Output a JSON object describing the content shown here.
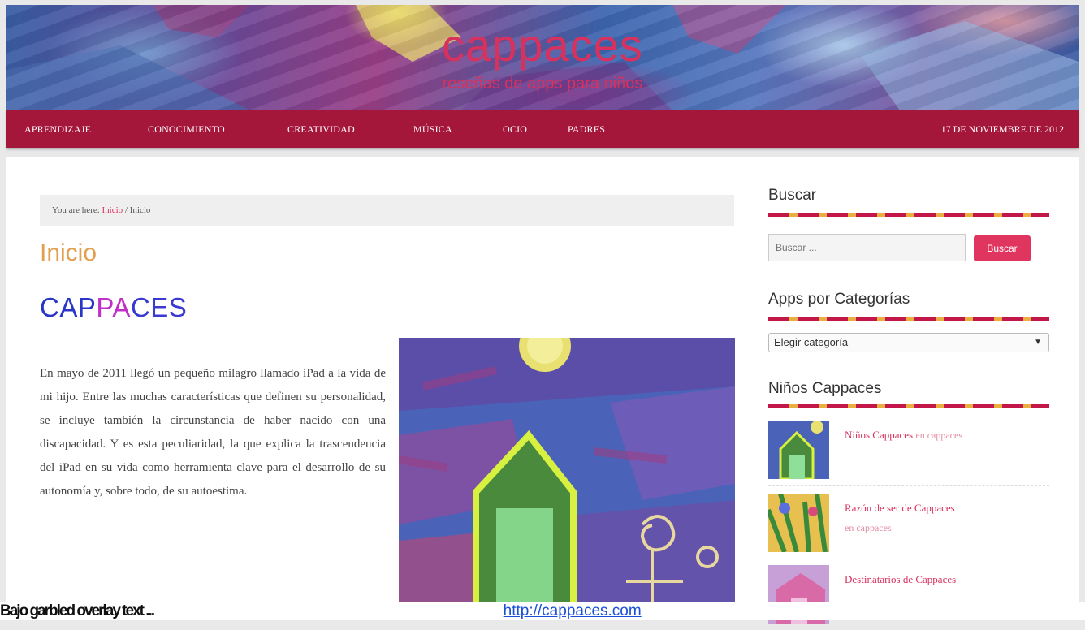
{
  "header": {
    "site_title": "cappaces",
    "tagline": "reseñas de apps para niños"
  },
  "nav": {
    "items": [
      {
        "label": "Aprendizaje"
      },
      {
        "label": "Conocimiento"
      },
      {
        "label": "Creatividad"
      },
      {
        "label": "Música"
      },
      {
        "label": "Ocio"
      },
      {
        "label": "Padres"
      }
    ],
    "date": "17 de noviembre de 2012"
  },
  "breadcrumb": {
    "prefix": "You are here: ",
    "link": "Inicio",
    "separator": " / ",
    "current": "Inicio"
  },
  "page": {
    "heading": "Inicio",
    "post_title_part1": "CAP",
    "post_title_part2": "PA",
    "post_title_part3": "CES",
    "paragraph": "En mayo de 2011 llegó un pequeño milagro llamado iPad a la vida de mi hijo. Entre las muchas características que definen su personalidad, se incluye también la circunstancia de haber nacido con una discapacidad. Y es esta peculiaridad, la que explica la trascendencia del iPad en su vida como herramienta clave para el desarrollo de su autonomía y, sobre todo, de su autoestima."
  },
  "sidebar": {
    "search_title": "Buscar",
    "search_placeholder": "Buscar ...",
    "search_button": "Buscar",
    "categories_title": "Apps por Categorías",
    "categories_selected": "Elegir categoría",
    "ninos_title": "Niños Cappaces",
    "posts": [
      {
        "title": "Niños Cappaces",
        "meta": "en cappaces"
      },
      {
        "title": "Razón de ser de Cappaces",
        "meta": "en cappaces"
      },
      {
        "title": "Destinatarios de Cappaces",
        "meta": ""
      }
    ]
  },
  "ticker": {
    "garbled": "Bajo garbled overlay text ...",
    "link": "http://cappaces.com"
  },
  "colors": {
    "accent": "#d8315d",
    "nav_bg": "#a4163a",
    "heading": "#e0a050"
  }
}
